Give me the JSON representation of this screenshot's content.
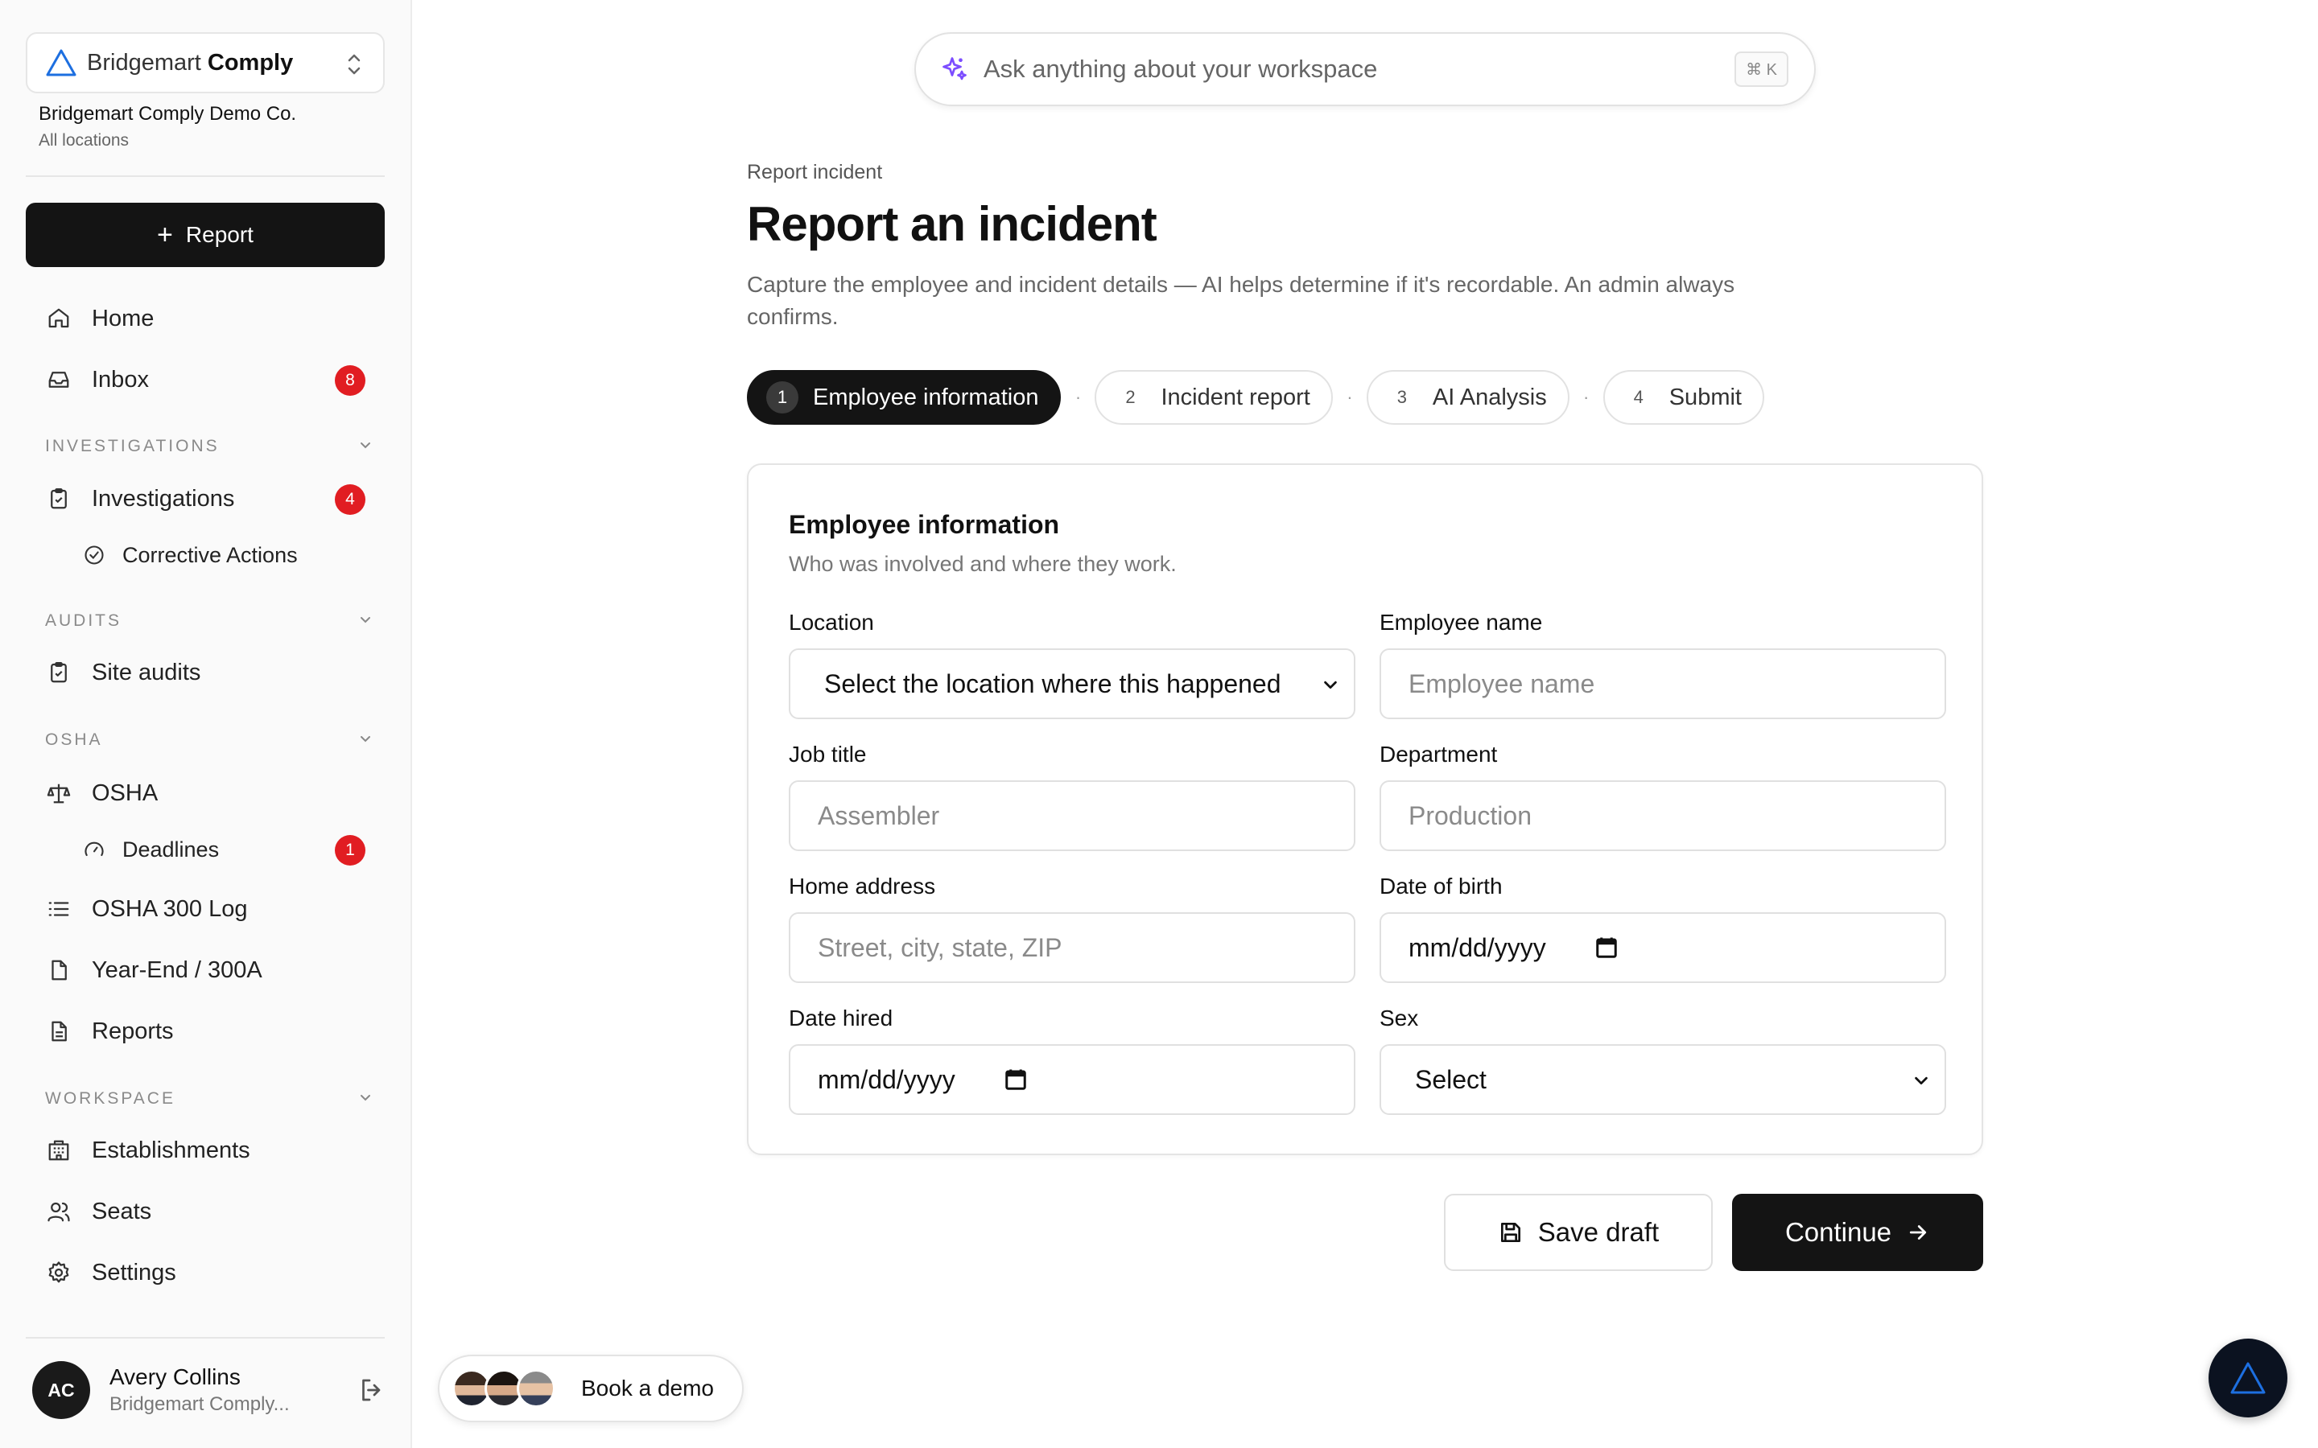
{
  "app": {
    "brand_light": "Bridgemart",
    "brand_bold": "Comply",
    "org_name": "Bridgemart Comply Demo Co.",
    "org_scope": "All locations",
    "accent_color": "#1d6fe0"
  },
  "sidebar": {
    "report_label": "Report",
    "home": "Home",
    "inbox": "Inbox",
    "inbox_count": "8",
    "sections": {
      "investigations": "INVESTIGATIONS",
      "audits": "AUDITS",
      "osha": "OSHA",
      "workspace": "WORKSPACE"
    },
    "investigations": "Investigations",
    "investigations_count": "4",
    "corrective_actions": "Corrective Actions",
    "site_audits": "Site audits",
    "osha": "OSHA",
    "deadlines": "Deadlines",
    "deadlines_count": "1",
    "osha_300_log": "OSHA 300 Log",
    "year_end": "Year-End / 300A",
    "reports": "Reports",
    "establishments": "Establishments",
    "seats": "Seats",
    "settings": "Settings"
  },
  "user": {
    "initials": "AC",
    "name": "Avery Collins",
    "org": "Bridgemart Comply..."
  },
  "search": {
    "placeholder": "Ask anything about your workspace",
    "shortcut": "⌘ K"
  },
  "page": {
    "breadcrumb": "Report incident",
    "title": "Report an incident",
    "description": "Capture the employee and incident details — AI helps determine if it's recordable. An admin always confirms."
  },
  "steps": [
    {
      "num": "1",
      "label": "Employee information"
    },
    {
      "num": "2",
      "label": "Incident report"
    },
    {
      "num": "3",
      "label": "AI Analysis"
    },
    {
      "num": "4",
      "label": "Submit"
    }
  ],
  "step_separator": "·",
  "form": {
    "title": "Employee information",
    "subtitle": "Who was involved and where they work.",
    "location_label": "Location",
    "location_value": "Select the location where this happened",
    "employee_name_label": "Employee name",
    "employee_name_placeholder": "Employee name",
    "job_title_label": "Job title",
    "job_title_placeholder": "Assembler",
    "department_label": "Department",
    "department_placeholder": "Production",
    "home_address_label": "Home address",
    "home_address_placeholder": "Street, city, state, ZIP",
    "dob_label": "Date of birth",
    "dob_value": "mm/dd/yyyy",
    "date_hired_label": "Date hired",
    "date_hired_value": "mm/dd/yyyy",
    "sex_label": "Sex",
    "sex_value": "Select"
  },
  "actions": {
    "save_draft": "Save draft",
    "continue": "Continue"
  },
  "demo": {
    "label": "Book a demo"
  }
}
